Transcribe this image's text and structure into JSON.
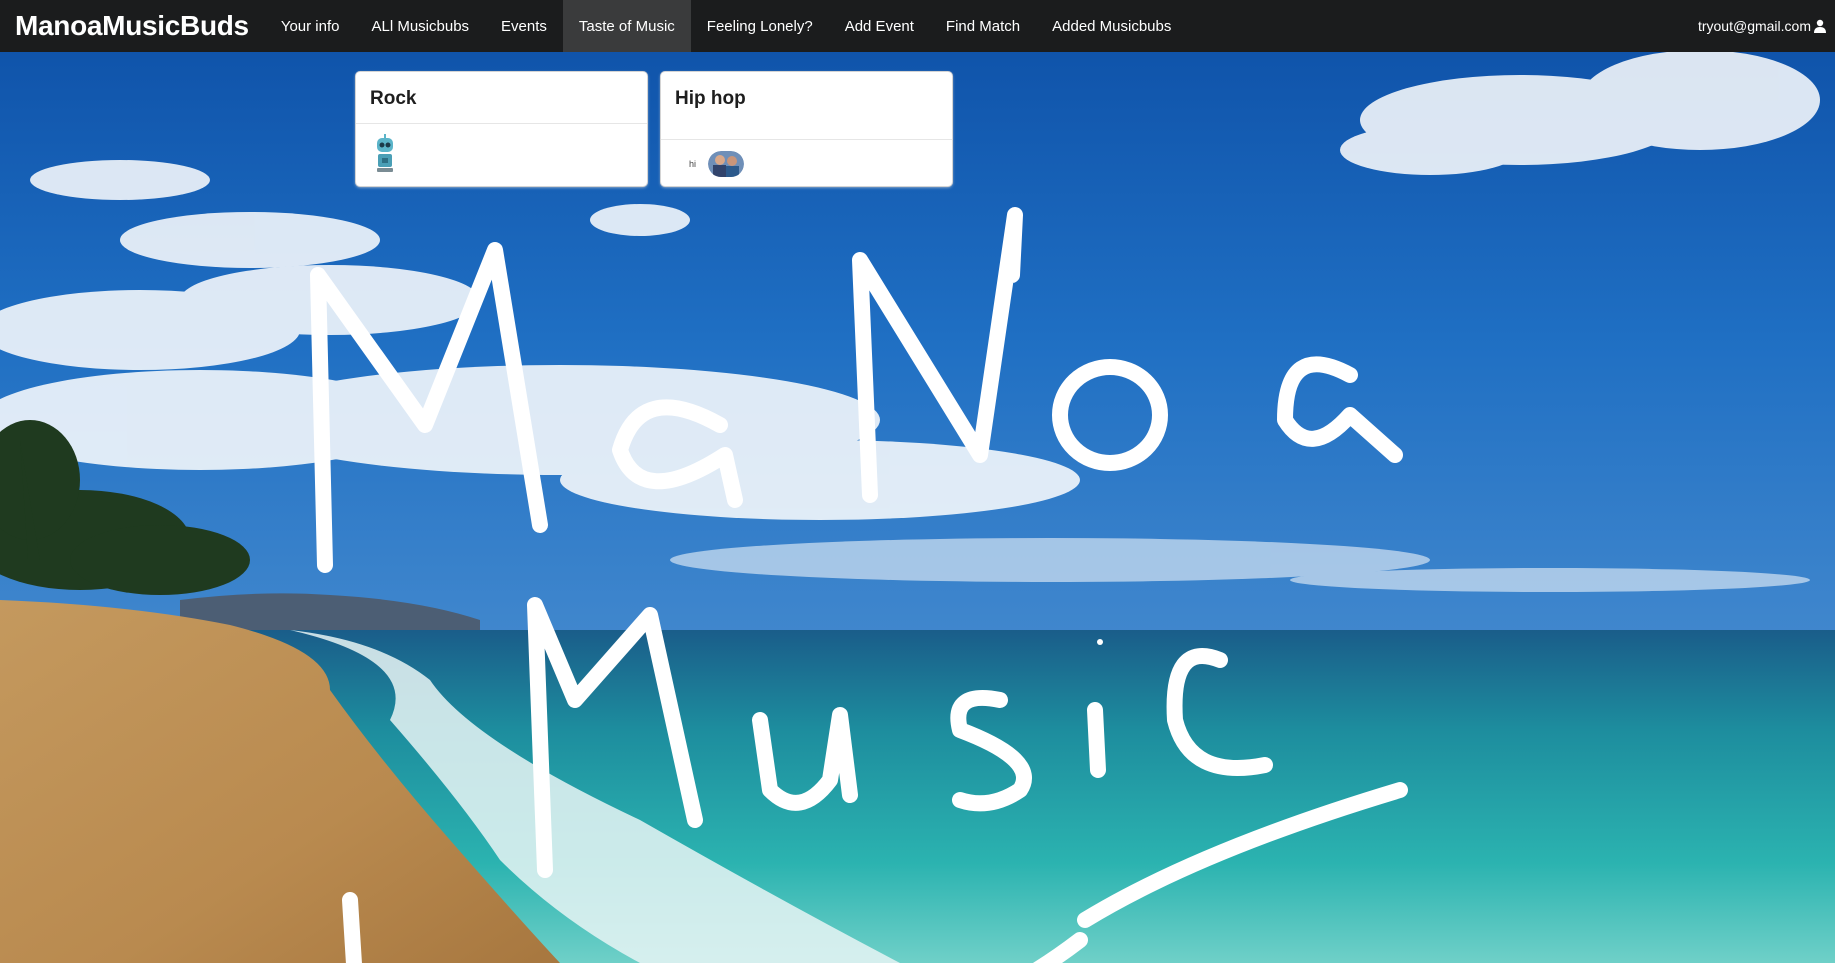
{
  "navbar": {
    "brand": "ManoaMusicBuds",
    "items": [
      {
        "label": "Your info",
        "active": false
      },
      {
        "label": "ALl Musicbubs",
        "active": false
      },
      {
        "label": "Events",
        "active": false
      },
      {
        "label": "Taste of Music",
        "active": true
      },
      {
        "label": "Feeling Lonely?",
        "active": false
      },
      {
        "label": "Add Event",
        "active": false
      },
      {
        "label": "Find Match",
        "active": false
      },
      {
        "label": "Added Musicbubs",
        "active": false
      }
    ],
    "user_email": "tryout@gmail.com",
    "user_icon": "user-icon"
  },
  "cards": [
    {
      "title": "Rock",
      "member_avatar": "robot-avatar"
    },
    {
      "title": "Hip hop",
      "member_note": "hi",
      "member_avatar": "people-avatar"
    }
  ],
  "background": {
    "scene": "beach-ocean-sky",
    "handwritten_overlay": "MaNoa Music Buds"
  },
  "colors": {
    "navbar_bg": "#1b1c1d",
    "navbar_active": "#3a3b3c",
    "card_bg": "#ffffff"
  }
}
